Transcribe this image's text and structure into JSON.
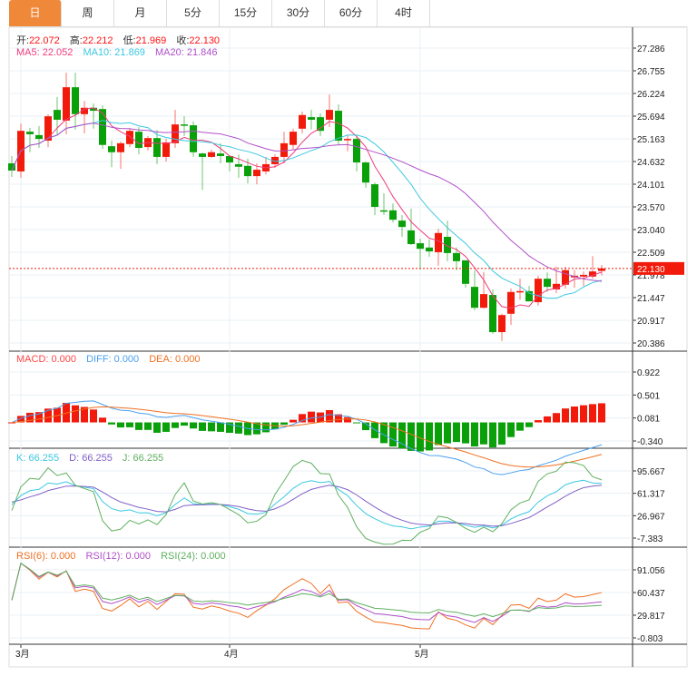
{
  "tabs": [
    "日",
    "周",
    "月",
    "5分",
    "15分",
    "30分",
    "60分",
    "4时"
  ],
  "active_tab": 0,
  "ohlc_legend": {
    "open_label": "开:",
    "open": "22.072",
    "high_label": "高:",
    "high": "22.212",
    "low_label": "低:",
    "low": "21.969",
    "close_label": "收:",
    "close": "22.130"
  },
  "ma_legend": {
    "ma5": "MA5: 22.052",
    "ma10": "MA10: 21.869",
    "ma20": "MA20: 21.846"
  },
  "macd_legend": {
    "macd": "MACD: 0.000",
    "diff": "DIFF: 0.000",
    "dea": "DEA: 0.000"
  },
  "kdj_legend": {
    "k": "K: 66.255",
    "d": "D: 66.255",
    "j": "J: 66.255"
  },
  "rsi_legend": {
    "rsi6": "RSI(6): 0.000",
    "rsi12": "RSI(12): 0.000",
    "rsi24": "RSI(24): 0.000"
  },
  "colors": {
    "up": "#f21b0b",
    "down": "#0aa00a",
    "ma5": "#f03c7c",
    "ma10": "#3cc8e0",
    "ma20": "#b050c8",
    "accent": "#f0883a"
  },
  "chart_data": {
    "type": "candlestick",
    "price_axis_ticks": [
      "27.286",
      "26.755",
      "26.224",
      "25.694",
      "25.163",
      "24.632",
      "24.101",
      "23.570",
      "23.040",
      "22.509",
      "21.978",
      "21.447",
      "20.917",
      "20.386"
    ],
    "last_price": "22.130",
    "price_range": [
      20.386,
      27.286
    ],
    "macd_axis_ticks": [
      "0.922",
      "0.501",
      "0.081",
      "-0.340"
    ],
    "kdj_axis_ticks": [
      "95.667",
      "61.317",
      "26.967",
      "-7.383"
    ],
    "rsi_axis_ticks": [
      "91.056",
      "60.437",
      "29.817",
      "-0.803"
    ],
    "x_labels": [
      {
        "label": "3月",
        "index": 1
      },
      {
        "label": "4月",
        "index": 24
      },
      {
        "label": "5月",
        "index": 45
      }
    ],
    "ohlc": [
      [
        24.59,
        24.76,
        24.27,
        24.42
      ],
      [
        24.4,
        25.52,
        24.25,
        25.35
      ],
      [
        25.33,
        25.42,
        24.85,
        25.27
      ],
      [
        25.25,
        25.46,
        24.95,
        25.16
      ],
      [
        25.12,
        25.74,
        24.97,
        25.69
      ],
      [
        25.84,
        26.14,
        25.27,
        25.61
      ],
      [
        25.59,
        26.71,
        25.27,
        26.37
      ],
      [
        26.37,
        26.71,
        25.38,
        25.74
      ],
      [
        25.74,
        26.05,
        25.29,
        25.89
      ],
      [
        25.89,
        25.99,
        25.4,
        25.82
      ],
      [
        25.86,
        25.95,
        24.93,
        25.02
      ],
      [
        24.99,
        25.12,
        24.5,
        24.85
      ],
      [
        24.85,
        25.1,
        24.46,
        25.06
      ],
      [
        25.04,
        25.42,
        24.97,
        25.35
      ],
      [
        25.33,
        25.44,
        24.8,
        24.95
      ],
      [
        24.97,
        25.23,
        24.89,
        25.18
      ],
      [
        25.18,
        25.37,
        24.57,
        24.74
      ],
      [
        24.74,
        25.16,
        24.63,
        25.08
      ],
      [
        25.06,
        25.84,
        24.95,
        25.5
      ],
      [
        25.5,
        25.69,
        25.23,
        25.48
      ],
      [
        25.48,
        25.57,
        24.74,
        24.85
      ],
      [
        24.82,
        24.84,
        23.97,
        24.74
      ],
      [
        24.74,
        24.91,
        24.72,
        24.85
      ],
      [
        24.82,
        25.06,
        24.59,
        24.76
      ],
      [
        24.76,
        24.78,
        24.4,
        24.61
      ],
      [
        24.57,
        24.8,
        24.25,
        24.51
      ],
      [
        24.53,
        24.7,
        24.12,
        24.29
      ],
      [
        24.29,
        24.59,
        24.1,
        24.44
      ],
      [
        24.4,
        24.74,
        24.33,
        24.57
      ],
      [
        24.57,
        24.8,
        24.48,
        24.74
      ],
      [
        24.74,
        25.33,
        24.59,
        25.06
      ],
      [
        25.02,
        25.4,
        24.91,
        25.33
      ],
      [
        25.4,
        25.8,
        25.29,
        25.72
      ],
      [
        25.67,
        25.84,
        25.38,
        25.61
      ],
      [
        25.67,
        25.76,
        25.23,
        25.35
      ],
      [
        25.61,
        26.2,
        25.44,
        25.84
      ],
      [
        25.82,
        25.97,
        25.02,
        25.12
      ],
      [
        25.14,
        25.25,
        24.87,
        25.16
      ],
      [
        25.16,
        25.23,
        24.4,
        24.61
      ],
      [
        24.61,
        24.63,
        24.02,
        24.14
      ],
      [
        24.1,
        24.14,
        23.38,
        23.57
      ],
      [
        23.49,
        23.89,
        23.38,
        23.46
      ],
      [
        23.49,
        23.65,
        23.21,
        23.27
      ],
      [
        23.25,
        23.38,
        22.87,
        23.1
      ],
      [
        23.02,
        23.53,
        22.68,
        22.7
      ],
      [
        22.72,
        22.83,
        22.11,
        22.59
      ],
      [
        22.62,
        22.81,
        22.4,
        22.53
      ],
      [
        22.51,
        23.06,
        22.19,
        22.96
      ],
      [
        22.87,
        23.25,
        22.3,
        22.49
      ],
      [
        22.49,
        22.62,
        22.09,
        22.3
      ],
      [
        22.32,
        22.32,
        21.68,
        21.77
      ],
      [
        21.7,
        22.09,
        21.15,
        21.21
      ],
      [
        21.21,
        22.05,
        21.19,
        21.53
      ],
      [
        21.51,
        21.64,
        20.6,
        20.64
      ],
      [
        20.64,
        21.07,
        20.43,
        21.04
      ],
      [
        21.07,
        21.66,
        20.81,
        21.58
      ],
      [
        21.58,
        21.89,
        21.4,
        21.6
      ],
      [
        21.6,
        21.72,
        21.36,
        21.36
      ],
      [
        21.34,
        21.96,
        21.26,
        21.89
      ],
      [
        21.89,
        22.04,
        21.58,
        21.7
      ],
      [
        21.64,
        22.17,
        21.55,
        21.77
      ],
      [
        21.75,
        22.17,
        21.66,
        22.09
      ],
      [
        21.92,
        22.09,
        21.68,
        21.96
      ],
      [
        21.94,
        22.06,
        21.72,
        21.98
      ],
      [
        21.94,
        22.42,
        21.89,
        22.06
      ],
      [
        22.072,
        22.212,
        21.969,
        22.13
      ]
    ]
  }
}
